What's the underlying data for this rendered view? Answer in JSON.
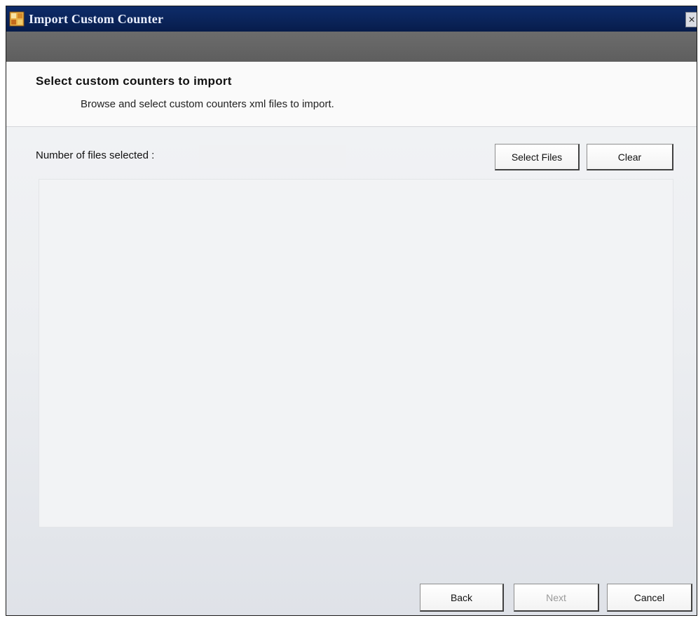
{
  "window": {
    "title": "Import Custom Counter",
    "close_label": "×"
  },
  "header": {
    "title": "Select custom counters to import",
    "subtitle": "Browse and select custom counters xml files to import."
  },
  "files": {
    "label": "Number of files selected :",
    "count_value": "",
    "select_button": "Select Files",
    "clear_button": "Clear",
    "list_items": []
  },
  "footer": {
    "back_button": "Back",
    "next_button": "Next",
    "next_enabled": false,
    "cancel_button": "Cancel"
  },
  "icons": {
    "app": "app-icon",
    "close": "close-icon"
  },
  "colors": {
    "titlebar": "#0a2358",
    "graybar": "#616161",
    "header_bg": "#fafafa",
    "body_bg": "#eceef1",
    "disabled_text": "#9a9a9a"
  }
}
